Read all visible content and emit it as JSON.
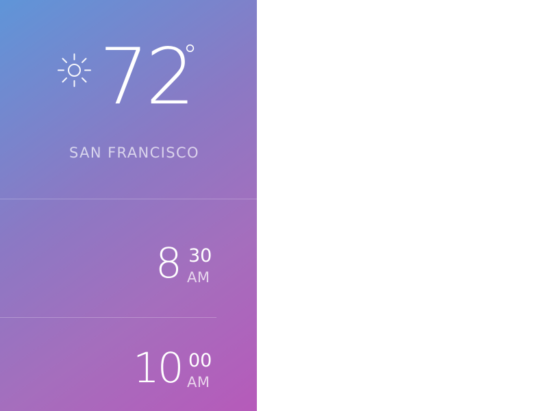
{
  "weather": {
    "temperature": "72",
    "degree_symbol": "°",
    "city": "SAN FRANCISCO",
    "icon": "sun-icon"
  },
  "alarms": [
    {
      "hour": "8",
      "minute": "30",
      "period": "AM"
    },
    {
      "hour": "10",
      "minute": "00",
      "period": "AM"
    }
  ],
  "colors": {
    "gradient_start": "#5f95d8",
    "gradient_mid": "#8b79c4",
    "gradient_end": "#b65aba",
    "text": "#ffffff",
    "muted_text": "#e7d9f3",
    "background": "#ffffff"
  }
}
